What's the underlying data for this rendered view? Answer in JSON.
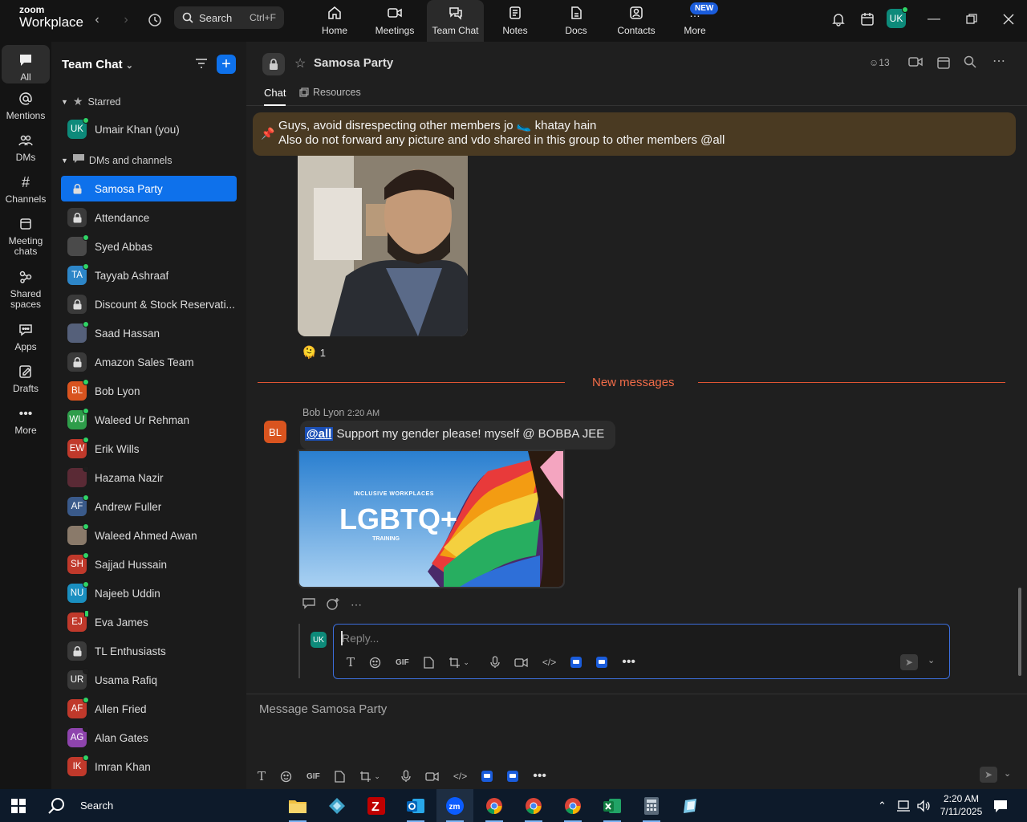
{
  "app": {
    "logo_line1": "zoom",
    "logo_line2": "Workplace",
    "search_label": "Search",
    "search_shortcut": "Ctrl+F",
    "accent": "#0e71eb",
    "top_tabs": [
      {
        "label": "Home",
        "icon": "home-icon"
      },
      {
        "label": "Meetings",
        "icon": "video-camera-icon"
      },
      {
        "label": "Team Chat",
        "icon": "chat-bubbles-icon",
        "active": true
      },
      {
        "label": "Notes",
        "icon": "notes-icon"
      },
      {
        "label": "Docs",
        "icon": "docs-icon"
      },
      {
        "label": "Contacts",
        "icon": "contacts-icon"
      },
      {
        "label": "More",
        "icon": "more-dots-icon"
      }
    ],
    "new_badge": "NEW",
    "user_initials": "UK"
  },
  "leftnav": [
    {
      "label": "All",
      "icon": "chat-icon",
      "active": true
    },
    {
      "label": "Mentions",
      "icon": "at-icon"
    },
    {
      "label": "DMs",
      "icon": "people-icon"
    },
    {
      "label": "Channels",
      "icon": "hash-icon"
    },
    {
      "label": "Meeting chats",
      "icon": "calendar-chat-icon"
    },
    {
      "label": "Shared spaces",
      "icon": "shared-spaces-icon"
    },
    {
      "label": "Apps",
      "icon": "apps-icon"
    },
    {
      "label": "Drafts",
      "icon": "drafts-icon"
    },
    {
      "label": "More",
      "icon": "more-dots-icon"
    }
  ],
  "sidebar": {
    "title": "Team Chat",
    "starred_label": "Starred",
    "starred": [
      {
        "name": "Umair Khan (you)",
        "initials": "UK",
        "color": "#0d8a7a",
        "status": "online",
        "kind": "avatar"
      }
    ],
    "dms_label": "DMs and channels",
    "items": [
      {
        "name": "Samosa Party",
        "kind": "lock",
        "selected": true
      },
      {
        "name": "Attendance",
        "kind": "lock"
      },
      {
        "name": "Syed Abbas",
        "kind": "photo",
        "status": "online",
        "color": "#4a4a4a"
      },
      {
        "name": "Tayyab Ashraaf",
        "initials": "TA",
        "color": "#2d86c8",
        "status": "online",
        "kind": "avatar"
      },
      {
        "name": "Discount & Stock Reservati...",
        "kind": "lock"
      },
      {
        "name": "Saad Hassan",
        "kind": "photo",
        "status": "online",
        "color": "#55607a"
      },
      {
        "name": "Amazon Sales Team",
        "kind": "lock"
      },
      {
        "name": "Bob Lyon",
        "initials": "BL",
        "color": "#d9541f",
        "status": "online",
        "kind": "avatar"
      },
      {
        "name": "Waleed Ur Rehman",
        "initials": "WU",
        "color": "#2e9d4a",
        "status": "online",
        "kind": "avatar"
      },
      {
        "name": "Erik Wills",
        "initials": "EW",
        "color": "#c0392b",
        "status": "online",
        "kind": "avatar"
      },
      {
        "name": "Hazama Nazir",
        "kind": "photo",
        "status": "away",
        "color": "#5a2a35"
      },
      {
        "name": "Andrew Fuller",
        "initials": "AF",
        "color": "#3a5a8a",
        "status": "online",
        "kind": "avatar"
      },
      {
        "name": "Waleed Ahmed Awan",
        "kind": "photo",
        "status": "online",
        "color": "#8a7a6a"
      },
      {
        "name": "Sajjad Hussain",
        "initials": "SH",
        "color": "#c0392b",
        "status": "online",
        "kind": "avatar"
      },
      {
        "name": "Najeeb Uddin",
        "initials": "NU",
        "color": "#1a8fc0",
        "status": "online",
        "kind": "avatar"
      },
      {
        "name": "Eva James",
        "initials": "EJ",
        "color": "#c0392b",
        "status": "mobile",
        "kind": "avatar"
      },
      {
        "name": "TL Enthusiasts",
        "kind": "lock"
      },
      {
        "name": "Usama Rafiq",
        "initials": "UR",
        "color": "#3a3a3a",
        "status": "offline",
        "kind": "avatar"
      },
      {
        "name": "Allen Fried",
        "initials": "AF",
        "color": "#c0392b",
        "status": "online",
        "kind": "avatar"
      },
      {
        "name": "Alan Gates",
        "initials": "AG",
        "color": "#8e44ad",
        "status": "offline",
        "kind": "avatar"
      },
      {
        "name": "Imran Khan",
        "initials": "IK",
        "color": "#c0392b",
        "status": "online",
        "kind": "avatar"
      }
    ]
  },
  "channel": {
    "title": "Samosa Party",
    "member_count": "13",
    "tabs": [
      "Chat",
      "Resources"
    ],
    "pinned_line1": "Guys, avoid disrespecting other members jo 🥿 khatay hain",
    "pinned_line2": "Also do not forward any picture and vdo shared in this group to other members @all",
    "reaction_emoji": "🫠",
    "reaction_count": "1",
    "new_messages_label": "New messages",
    "message": {
      "author": "Bob Lyon",
      "time": "2:20 AM",
      "initials": "BL",
      "mention": "@all",
      "text": "Support my gender please! myself @ BOBBA JEE"
    },
    "banner": {
      "top": "INCLUSIVE WORKPLACES",
      "main": "LGBTQ+",
      "bottom": "TRAINING"
    },
    "reply_placeholder": "Reply...",
    "reply_initials": "UK",
    "compose_placeholder": "Message Samosa Party",
    "gif_label": "GIF"
  },
  "taskbar": {
    "search_label": "Search",
    "time": "2:20 AM",
    "date": "7/11/2025"
  }
}
